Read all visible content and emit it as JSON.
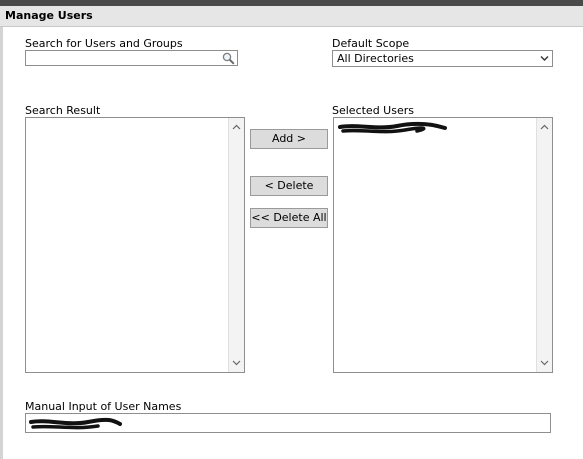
{
  "window": {
    "title": "Manage Users"
  },
  "search": {
    "label": "Search for Users and Groups",
    "value": "",
    "placeholder": ""
  },
  "scope": {
    "label": "Default Scope",
    "selected": "All Directories"
  },
  "search_result": {
    "label": "Search Result",
    "items": []
  },
  "selected_users": {
    "label": "Selected Users",
    "items": [
      "[redacted]"
    ]
  },
  "actions": {
    "add": "Add >",
    "delete": "< Delete",
    "delete_all": "<< Delete All"
  },
  "manual_input": {
    "label": "Manual Input of User Names",
    "value": ""
  },
  "colors": {
    "titlebar_bg": "#e6e6e6",
    "button_bg": "#dcdcdc",
    "border": "#8e8e8e"
  }
}
